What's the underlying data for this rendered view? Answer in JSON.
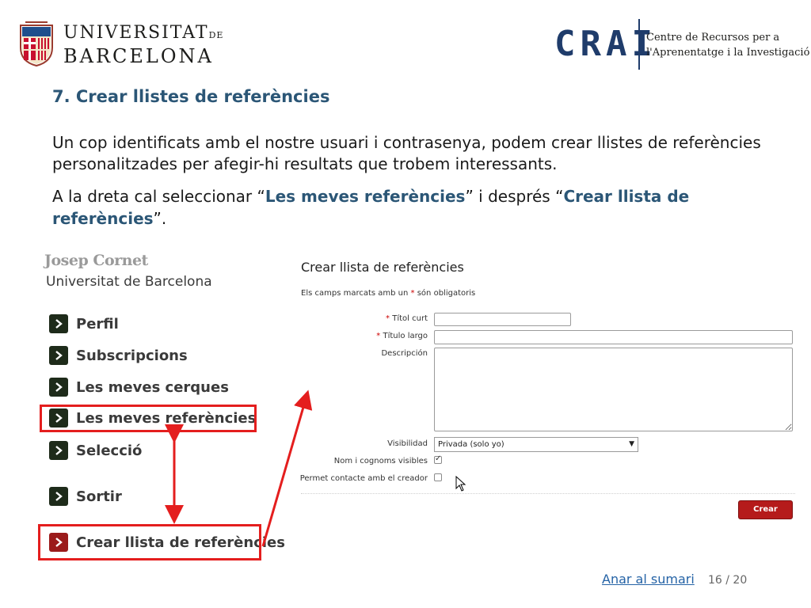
{
  "header": {
    "ub_line1_main": "UNIVERSITAT",
    "ub_line1_small": "DE",
    "ub_line2": "BARCELONA",
    "crai_mark": "CRAI",
    "crai_line1": "Centre de Recursos per a",
    "crai_line2": "l'Aprenentatge i la Investigació"
  },
  "slide": {
    "title": "7. Crear llistes de referències",
    "para1": "Un cop identificats amb el nostre usuari i contrasenya, podem crear llistes de referències personalitzades per afegir-hi resultats que trobem interessants.",
    "para2_a": "A la dreta cal seleccionar “",
    "para2_b": "Les meves referències",
    "para2_c": "” i després “",
    "para2_d": "Crear llista de referències",
    "para2_e": "”."
  },
  "menu": {
    "user_name": "Josep Cornet",
    "institution": "Universitat de Barcelona",
    "items": [
      {
        "label": "Perfil"
      },
      {
        "label": "Subscripcions"
      },
      {
        "label": "Les meves cerques"
      },
      {
        "label": "Les meves referències"
      },
      {
        "label": "Selecció"
      },
      {
        "label": "Sortir"
      },
      {
        "label": "Crear llista de referències"
      }
    ]
  },
  "form": {
    "title": "Crear llista de referències",
    "note_a": "Els camps marcats amb un ",
    "note_star": "*",
    "note_b": " són obligatoris",
    "star": "*",
    "label_titol_curt": "Títol curt",
    "label_titulo_largo": "Título largo",
    "label_descripcion": "Descripción",
    "label_visibilidad": "Visibilidad",
    "label_nom_visibles": "Nom i cognoms visibles",
    "label_permet": "Permet contacte amb el creador",
    "visibility_value": "Privada (solo yo)",
    "caret": "▼",
    "button": "Crear",
    "nom_visibles_checked": true,
    "permet_checked": false
  },
  "footer": {
    "link": "Anar al sumari",
    "page": "16 / 20"
  },
  "colors": {
    "title_blue": "#2b5676",
    "highlight_red": "#e41e1e",
    "button_red": "#b51b1b",
    "link_blue": "#2563a6",
    "crai_blue": "#1f3c6b"
  }
}
